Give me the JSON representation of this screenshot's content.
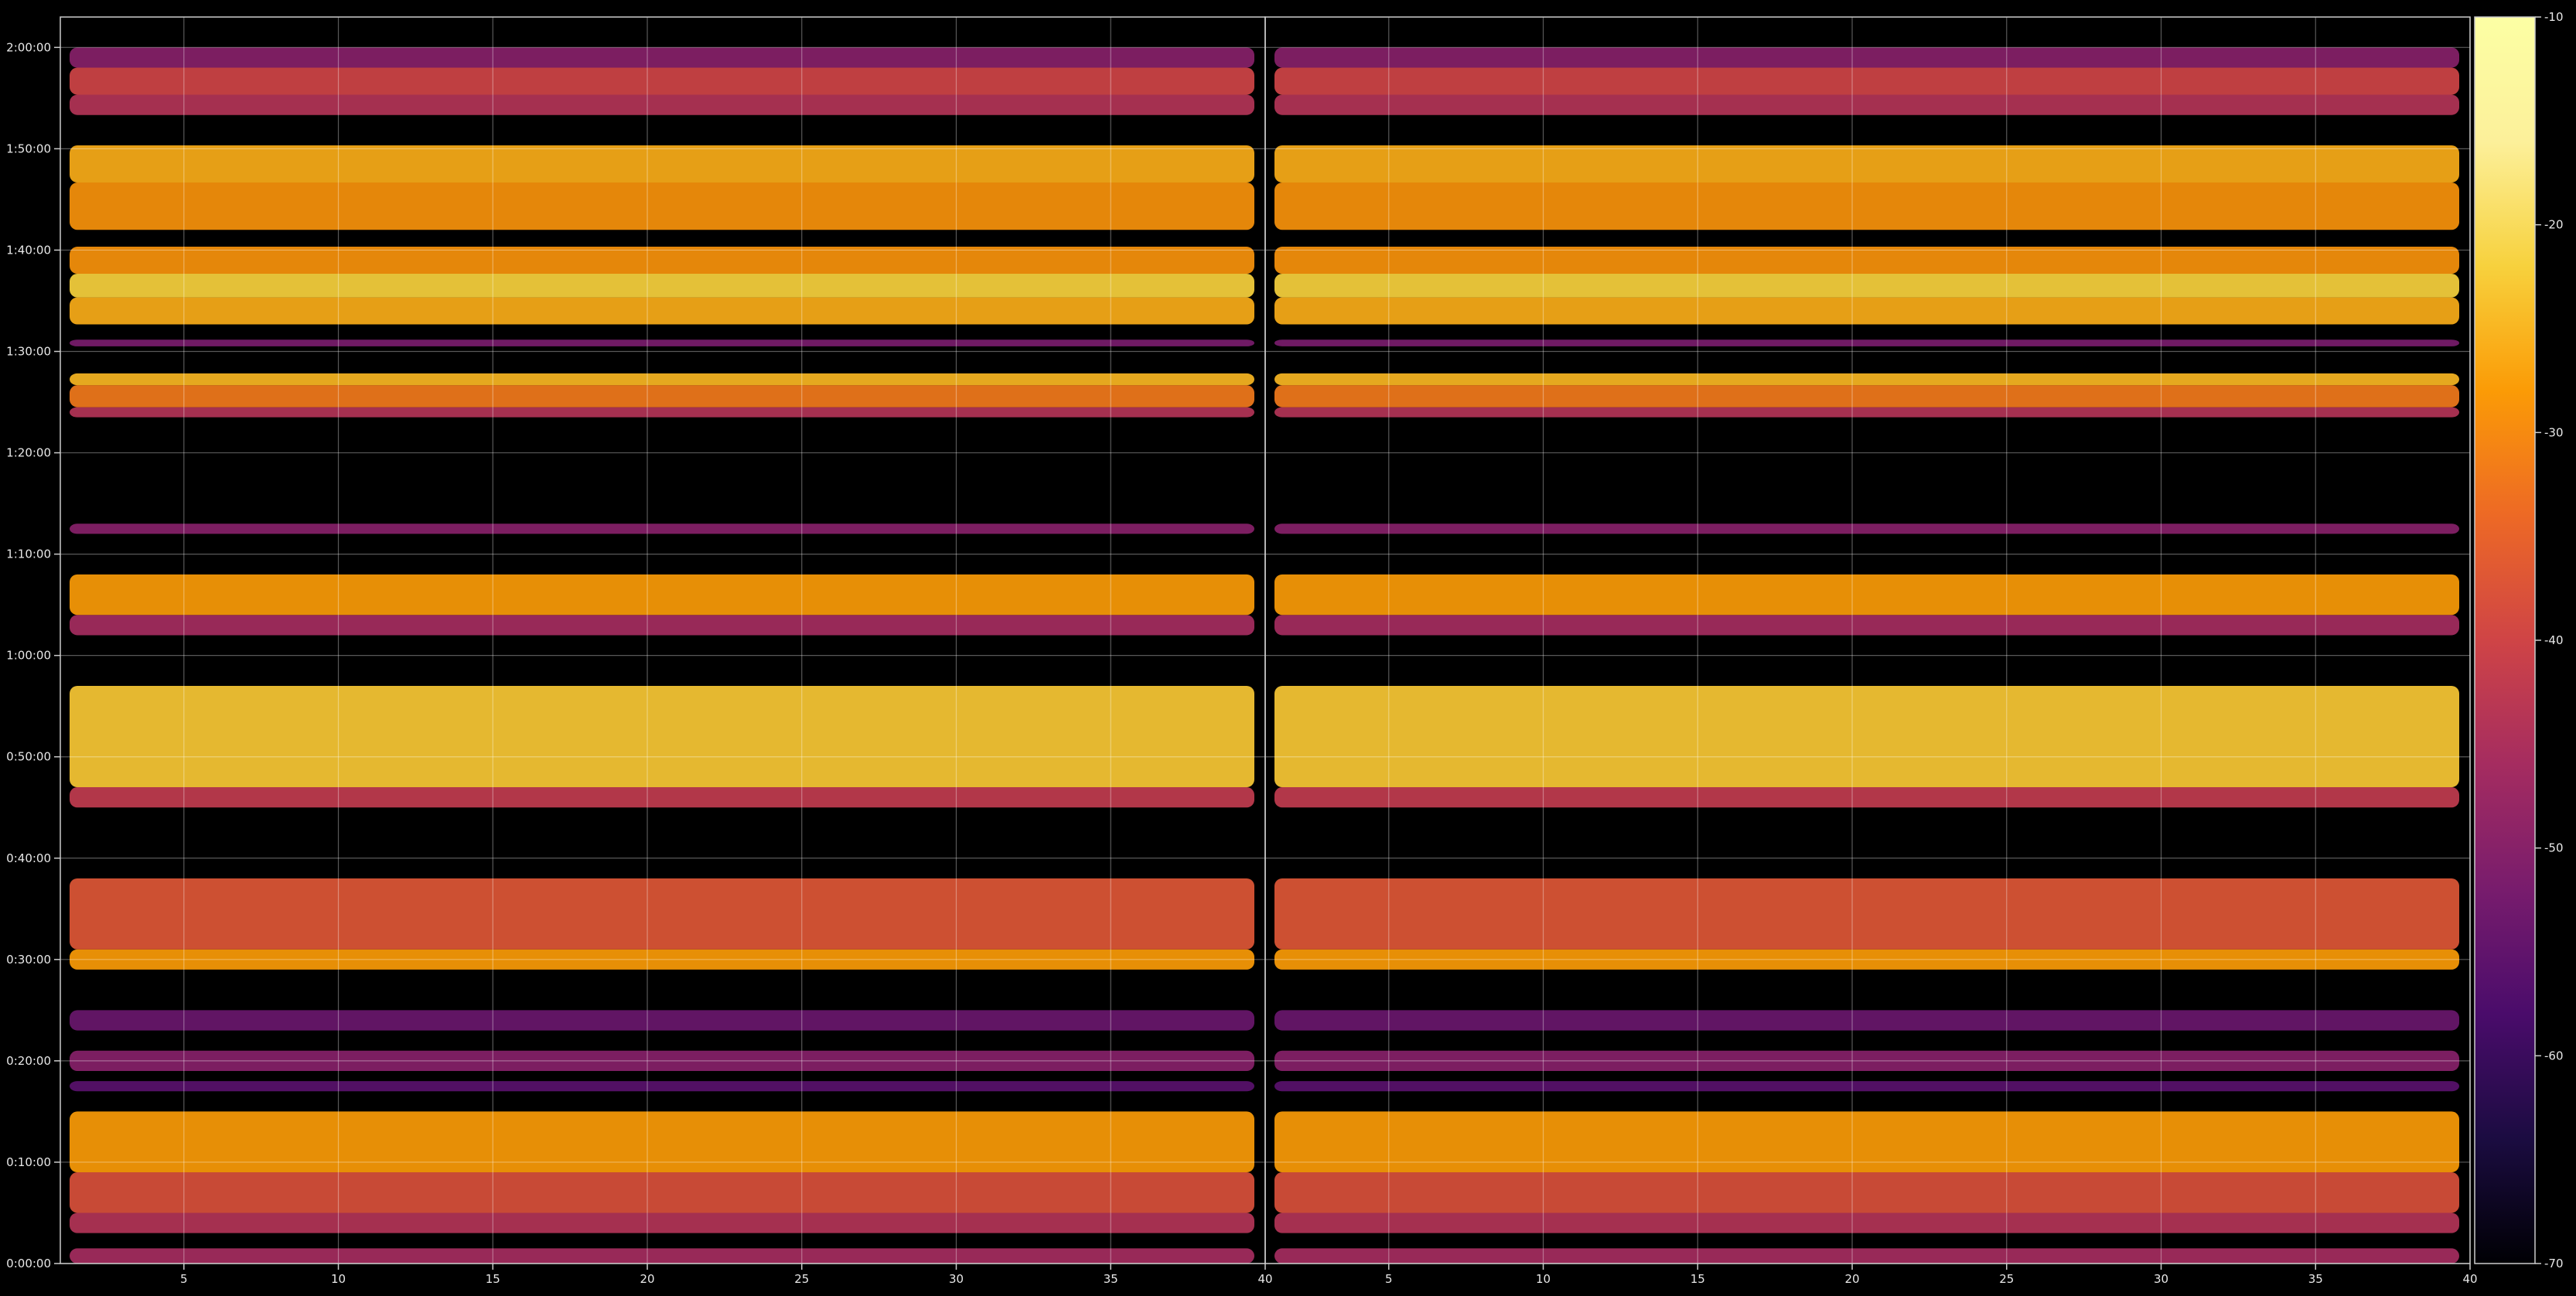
{
  "chart_data": {
    "type": "heatmap",
    "title": "",
    "xlabel": "",
    "ylabel": "",
    "panels": [
      {
        "name": "",
        "x_range": [
          1,
          40
        ],
        "x_ticks": [
          5,
          10,
          15,
          20,
          25,
          30,
          35,
          40
        ]
      },
      {
        "name": "",
        "x_range": [
          1,
          40
        ],
        "x_ticks": [
          5,
          10,
          15,
          20,
          25,
          30,
          35,
          40
        ]
      }
    ],
    "y_range_seconds": [
      0,
      7380
    ],
    "y_ticks": [
      {
        "label": "0:00:00",
        "value": 0
      },
      {
        "label": "0:10:00",
        "value": 600
      },
      {
        "label": "0:20:00",
        "value": 1200
      },
      {
        "label": "0:30:00",
        "value": 1800
      },
      {
        "label": "0:40:00",
        "value": 2400
      },
      {
        "label": "0:50:00",
        "value": 3000
      },
      {
        "label": "1:00:00",
        "value": 3600
      },
      {
        "label": "1:10:00",
        "value": 4200
      },
      {
        "label": "1:20:00",
        "value": 4800
      },
      {
        "label": "1:30:00",
        "value": 5400
      },
      {
        "label": "1:40:00",
        "value": 6000
      },
      {
        "label": "1:50:00",
        "value": 6600
      },
      {
        "label": "2:00:00",
        "value": 7200
      }
    ],
    "colorbar": {
      "colormap": "inferno",
      "range": [
        -70,
        -10
      ],
      "ticks": [
        -10,
        -20,
        -30,
        -40,
        -50,
        -60,
        -70
      ]
    },
    "grid": true,
    "background": "#000000",
    "bands": [
      {
        "y_start": 0,
        "y_end": 90,
        "level": -46
      },
      {
        "y_start": 180,
        "y_end": 300,
        "level": -44
      },
      {
        "y_start": 300,
        "y_end": 540,
        "level": -38
      },
      {
        "y_start": 540,
        "y_end": 900,
        "level": -28
      },
      {
        "y_start": 1020,
        "y_end": 1080,
        "level": -56
      },
      {
        "y_start": 1140,
        "y_end": 1260,
        "level": -50
      },
      {
        "y_start": 1380,
        "y_end": 1500,
        "level": -54
      },
      {
        "y_start": 1740,
        "y_end": 1860,
        "level": -28
      },
      {
        "y_start": 1860,
        "y_end": 2280,
        "level": -37
      },
      {
        "y_start": 2700,
        "y_end": 2820,
        "level": -42
      },
      {
        "y_start": 2820,
        "y_end": 3420,
        "level": -23
      },
      {
        "y_start": 3720,
        "y_end": 3840,
        "level": -46
      },
      {
        "y_start": 3840,
        "y_end": 4080,
        "level": -28
      },
      {
        "y_start": 4320,
        "y_end": 4380,
        "level": -50
      },
      {
        "y_start": 5010,
        "y_end": 5070,
        "level": -44
      },
      {
        "y_start": 5070,
        "y_end": 5200,
        "level": -32
      },
      {
        "y_start": 5200,
        "y_end": 5270,
        "level": -25
      },
      {
        "y_start": 5430,
        "y_end": 5470,
        "level": -52
      },
      {
        "y_start": 5560,
        "y_end": 5720,
        "level": -26
      },
      {
        "y_start": 5720,
        "y_end": 5860,
        "level": -22
      },
      {
        "y_start": 5860,
        "y_end": 6020,
        "level": -29
      },
      {
        "y_start": 6120,
        "y_end": 6400,
        "level": -29
      },
      {
        "y_start": 6400,
        "y_end": 6620,
        "level": -26
      },
      {
        "y_start": 6800,
        "y_end": 6920,
        "level": -44
      },
      {
        "y_start": 6920,
        "y_end": 7080,
        "level": -40
      },
      {
        "y_start": 7080,
        "y_end": 7200,
        "level": -50
      }
    ]
  }
}
